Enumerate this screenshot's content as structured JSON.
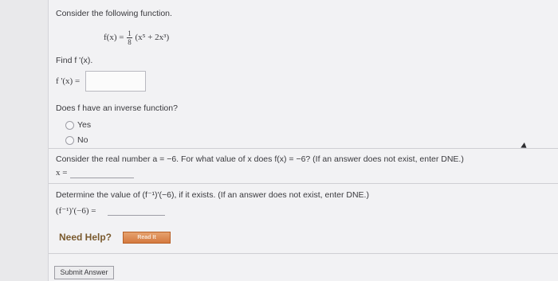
{
  "intro": "Consider the following function.",
  "function": {
    "lhs": "f(x) =",
    "frac_num": "1",
    "frac_den": "8",
    "rhs": "(x⁵ + 2x³)"
  },
  "part1": {
    "prompt": "Find f '(x).",
    "label": "f '(x) ="
  },
  "part2": {
    "question": "Does f have an inverse function?",
    "options": [
      "Yes",
      "No"
    ]
  },
  "part3": {
    "prompt": "Consider the real number a = −6. For what value of x does f(x) = −6? (If an answer does not exist, enter DNE.)",
    "label": "x ="
  },
  "part4": {
    "prompt": "Determine the value of (f⁻¹)′(−6), if it exists. (If an answer does not exist, enter DNE.)",
    "label": "(f⁻¹)′(−6) ="
  },
  "help": {
    "label": "Need Help?",
    "read_button": "Read It"
  },
  "submit_label": "Submit Answer"
}
